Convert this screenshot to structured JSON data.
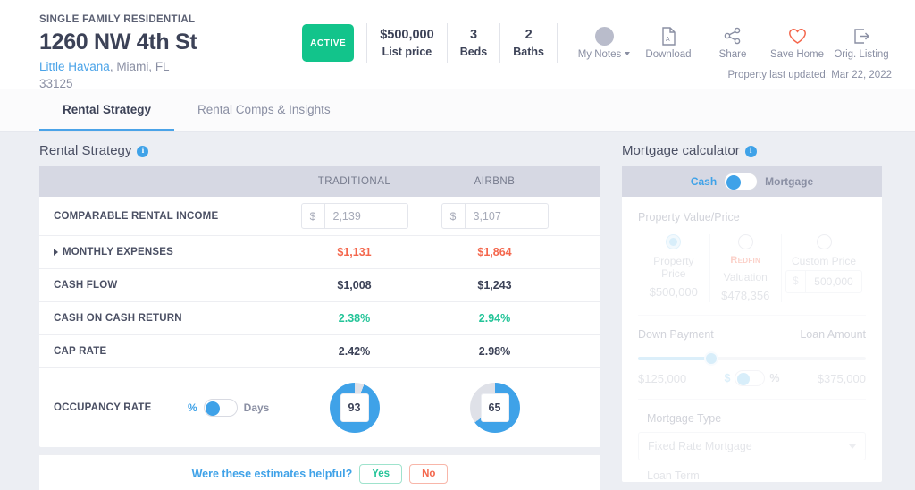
{
  "header": {
    "property_type": "SINGLE FAMILY RESIDENTIAL",
    "address": "1260 NW 4th St",
    "neighborhood": "Little Havana",
    "city_state": ", Miami, FL",
    "zip": "33125",
    "status_badge": "ACTIVE",
    "facts": [
      {
        "value": "$500,000",
        "label": "List price"
      },
      {
        "value": "3",
        "label": "Beds"
      },
      {
        "value": "2",
        "label": "Baths"
      }
    ],
    "actions": [
      {
        "icon": "notes-circle-icon",
        "label": "My Notes"
      },
      {
        "icon": "download-pdf-icon",
        "label": "Download"
      },
      {
        "icon": "share-icon",
        "label": "Share"
      },
      {
        "icon": "heart-icon",
        "label": "Save Home"
      },
      {
        "icon": "external-link-icon",
        "label": "Orig. Listing"
      }
    ],
    "last_updated": "Property last updated: Mar 22, 2022"
  },
  "tabs": [
    {
      "label": "Rental Strategy",
      "active": true
    },
    {
      "label": "Rental Comps & Insights",
      "active": false
    }
  ],
  "rental_strategy": {
    "title": "Rental Strategy",
    "info_icon": "i",
    "columns": [
      "TRADITIONAL",
      "AIRBNB"
    ],
    "rows": [
      {
        "label": "COMPARABLE RENTAL INCOME",
        "type": "input",
        "prefix": "$",
        "traditional": "2,139",
        "airbnb": "3,107"
      },
      {
        "label": "MONTHLY EXPENSES",
        "type": "expandable",
        "traditional": "$1,131",
        "airbnb": "$1,864",
        "color": "red"
      },
      {
        "label": "CASH FLOW",
        "type": "value",
        "traditional": "$1,008",
        "airbnb": "$1,243",
        "color": "dark"
      },
      {
        "label": "CASH ON CASH RETURN",
        "type": "value",
        "traditional": "2.38%",
        "airbnb": "2.94%",
        "color": "green"
      },
      {
        "label": "CAP RATE",
        "type": "value",
        "traditional": "2.42%",
        "airbnb": "2.98%",
        "color": "dark"
      }
    ],
    "occupancy": {
      "label": "OCCUPANCY RATE",
      "toggle_left": "%",
      "toggle_right": "Days",
      "toggle_state": "left",
      "traditional": "93",
      "airbnb": "65"
    },
    "feedback": {
      "question": "Were these estimates helpful?",
      "yes": "Yes",
      "no": "No"
    }
  },
  "mortgage": {
    "title": "Mortgage calculator",
    "info_icon": "i",
    "toggle_left": "Cash",
    "toggle_right": "Mortgage",
    "toggle_state": "left",
    "property_value_label": "Property Value/Price",
    "options": [
      {
        "label": "Property Price",
        "value": "$500,000",
        "selected": true,
        "brand": ""
      },
      {
        "label": "Valuation",
        "value": "$478,356",
        "selected": false,
        "brand": "Redfin"
      },
      {
        "label": "Custom Price",
        "value": "500,000",
        "selected": false,
        "prefix": "$"
      }
    ],
    "down_payment_label": "Down Payment",
    "loan_amount_label": "Loan Amount",
    "down_payment_value": "$125,000",
    "loan_amount_value": "$375,000",
    "unit_toggle_left": "$",
    "unit_toggle_right": "%",
    "mortgage_type_label": "Mortgage Type",
    "mortgage_type_value": "Fixed Rate Mortgage",
    "loan_term_label": "Loan Term"
  },
  "colors": {
    "accent_blue": "#3fa2e8",
    "active_green": "#12c48b",
    "positive_green": "#23c498",
    "negative_red": "#f4674d",
    "header_gray": "#d6d8e3",
    "body_bg": "#eceef3"
  }
}
